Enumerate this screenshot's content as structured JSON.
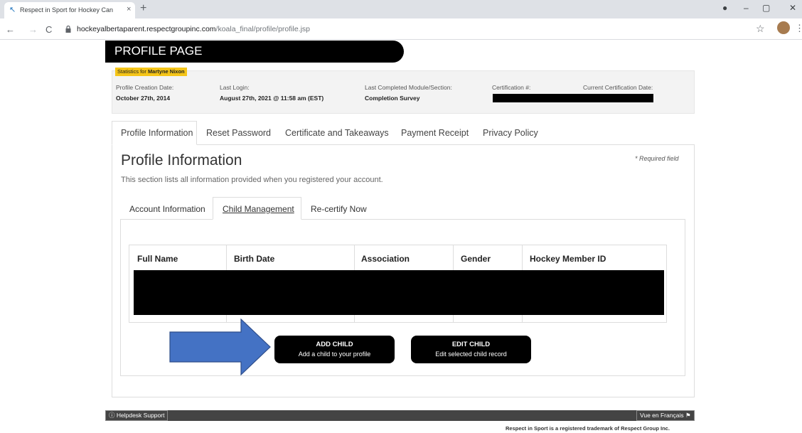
{
  "browser": {
    "tab_title": "Respect in Sport for Hockey Can",
    "url_host": "hockeyalbertaparent.respectgroupinc.com",
    "url_path": "/koala_final/profile/profile.jsp",
    "new_tab": "+",
    "tab_close": "×",
    "back": "←",
    "forward": "→",
    "reload": "C",
    "lock": "🔒",
    "star": "☆",
    "menu": "⋮",
    "minimize": "–",
    "maximize": "▢",
    "close": "✕",
    "record": "●"
  },
  "page": {
    "title": "PROFILE PAGE"
  },
  "stats": {
    "badge_prefix": "Statistics for ",
    "badge_name": "Martyne Nixon",
    "profile_creation_label": "Profile Creation Date:",
    "profile_creation_value": "October 27th, 2014",
    "last_login_label": "Last Login:",
    "last_login_value": "August 27th, 2021 @ 11:58 am (EST)",
    "last_module_label": "Last Completed Module/Section:",
    "last_module_value": "Completion Survey",
    "cert_label": "Certification #:",
    "current_cert_label": "Current Certification Date:"
  },
  "main_tabs": [
    {
      "label": "Profile Information"
    },
    {
      "label": "Reset Password"
    },
    {
      "label": "Certificate and Takeaways"
    },
    {
      "label": "Payment Receipt"
    },
    {
      "label": "Privacy Policy"
    }
  ],
  "profile": {
    "heading": "Profile Information",
    "required_note": "* Required field",
    "intro": "This section lists all information provided when you registered your account."
  },
  "sub_tabs": [
    {
      "label": "Account Information"
    },
    {
      "label": "Child Management"
    },
    {
      "label": "Re-certify Now"
    }
  ],
  "table": {
    "columns": [
      "Full Name",
      "Birth Date",
      "Association",
      "Gender",
      "Hockey Member ID"
    ]
  },
  "buttons": {
    "add_title": "ADD CHILD",
    "add_sub": "Add a child to your profile",
    "edit_title": "EDIT CHILD",
    "edit_sub": "Edit selected child record"
  },
  "footer": {
    "helpdesk": "Helpdesk Support",
    "french": "Vue en Français",
    "trademark": "Respect in Sport is a registered trademark of Respect Group Inc."
  },
  "colors": {
    "arrow": "#4472c4",
    "badge": "#f5c518"
  }
}
